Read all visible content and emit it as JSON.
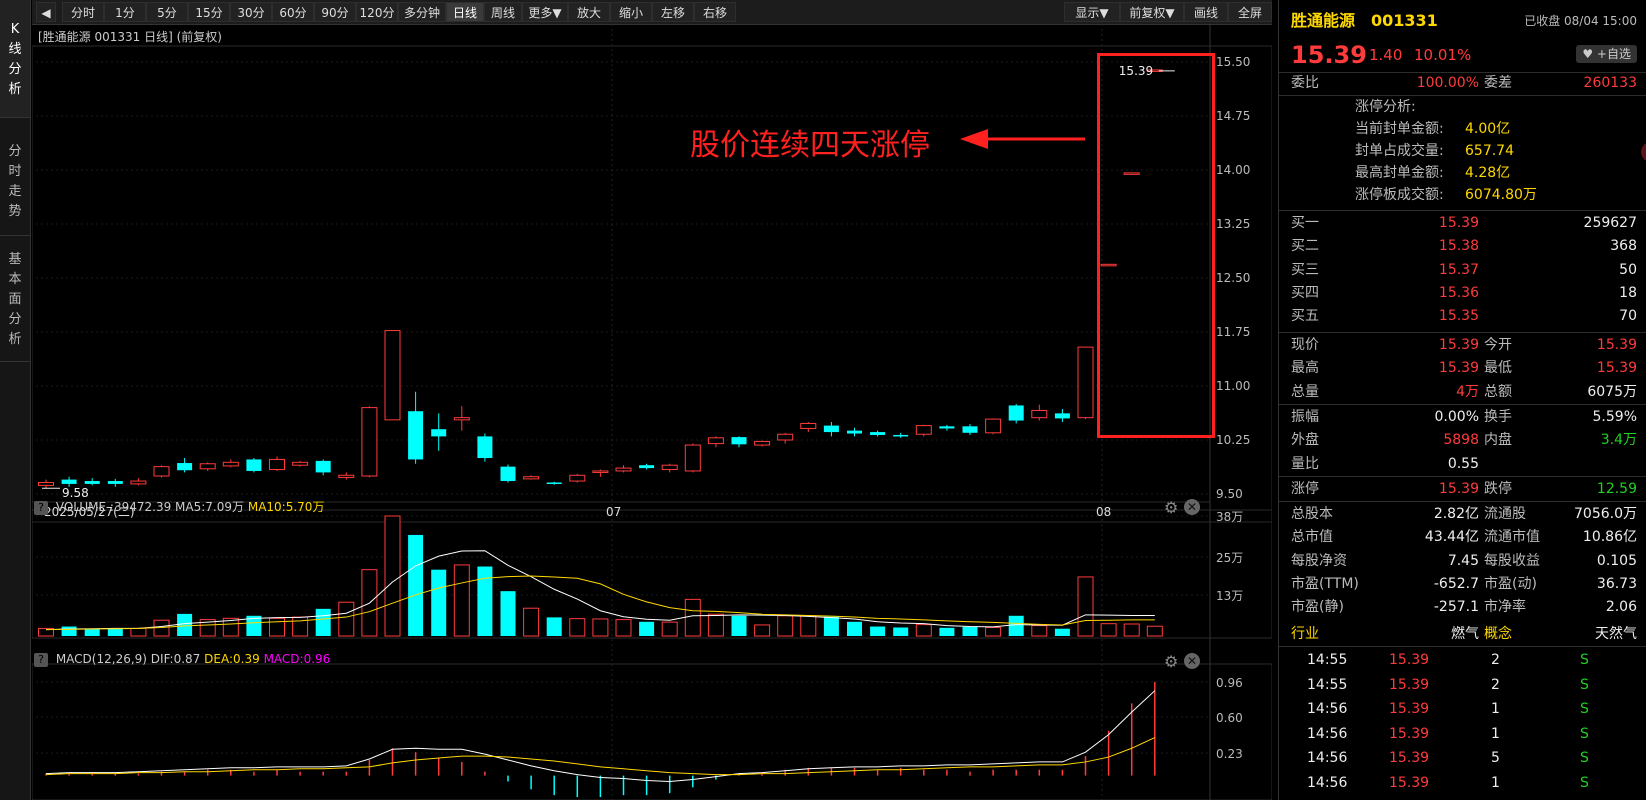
{
  "toolbar": {
    "back_label": "◀",
    "items": [
      "分时",
      "1分",
      "5分",
      "15分",
      "30分",
      "60分",
      "90分",
      "120分",
      "多分钟",
      "日线",
      "周线",
      "更多▼",
      "放大",
      "缩小",
      "左移",
      "右移"
    ],
    "right_items": [
      "显示▼",
      "前复权▼",
      "画线",
      "全屏"
    ]
  },
  "side_tabs": [
    {
      "label": "K线分析"
    },
    {
      "label": "分时走势"
    },
    {
      "label": "基本面分析"
    }
  ],
  "kline": {
    "header": "[胜通能源 001331 日线] (前复权)",
    "annotation": "股价连续四天涨停",
    "last_price_label": "15.39",
    "low_label": "9.58",
    "date_labels": [
      "2025/05/27(二)",
      "07",
      "08"
    ],
    "y_ticks": [
      "15.50",
      "14.75",
      "14.00",
      "13.25",
      "12.50",
      "11.75",
      "11.00",
      "10.25",
      "9.50"
    ]
  },
  "volume": {
    "help": "?",
    "name": "VOLUME",
    "value": ":39472.39",
    "ma5": "MA5:7.09万",
    "ma10": "MA10:5.70万",
    "y_ticks": [
      "38万",
      "25万",
      "13万"
    ]
  },
  "macd": {
    "help": "?",
    "name": "MACD(12,26,9)",
    "dif": "DIF:0.87",
    "dea": "DEA:0.39",
    "macd": "MACD:0.96",
    "y_ticks": [
      "0.96",
      "0.60",
      "0.23"
    ]
  },
  "colors": {
    "up": "#ff3b3b",
    "down": "#00ffff",
    "ma5": "#ffffff",
    "ma10": "#ffd800",
    "macd": "#ff00ff",
    "annotation": "#ff2020"
  },
  "quote": {
    "name": "胜通能源",
    "code": "001331",
    "status": "已收盘 08/04 15:00",
    "price": "15.39",
    "change": "1.40",
    "pct": "10.01%",
    "watch_button": "♥ +自选",
    "webi_label": "委比",
    "webi": "100.00%",
    "weicha_label": "委差",
    "weicha": "260133",
    "limit_title": "涨停分析:",
    "limit_rows": [
      {
        "label": "当前封单金额:",
        "value": "4.00亿"
      },
      {
        "label": "封单占成交量:",
        "value": "657.74"
      },
      {
        "label": "最高封单金额:",
        "value": "4.28亿"
      },
      {
        "label": "涨停板成交额:",
        "value": "6074.80万"
      }
    ],
    "bids": [
      {
        "label": "买一",
        "price": "15.39",
        "vol": "259627"
      },
      {
        "label": "买二",
        "price": "15.38",
        "vol": "368"
      },
      {
        "label": "买三",
        "price": "15.37",
        "vol": "50"
      },
      {
        "label": "买四",
        "price": "15.36",
        "vol": "18"
      },
      {
        "label": "买五",
        "price": "15.35",
        "vol": "70"
      }
    ],
    "stats": [
      {
        "l1": "现价",
        "v1": "15.39",
        "l2": "今开",
        "v2": "15.39"
      },
      {
        "l1": "最高",
        "v1": "15.39",
        "l2": "最低",
        "v2": "15.39"
      },
      {
        "l1": "总量",
        "v1": "4万",
        "l2": "总额",
        "v2": "6075万"
      }
    ],
    "stats2": [
      {
        "l1": "振幅",
        "v1": "0.00%",
        "l2": "换手",
        "v2": "5.59%"
      },
      {
        "l1": "外盘",
        "v1": "5898",
        "l2": "内盘",
        "v2": "3.4万"
      },
      {
        "l1": "量比",
        "v1": "0.55",
        "l2": "",
        "v2": ""
      }
    ],
    "limit_up_label": "涨停",
    "limit_up": "15.39",
    "limit_down_label": "跌停",
    "limit_down": "12.59",
    "fundamentals": [
      {
        "l1": "总股本",
        "v1": "2.82亿",
        "l2": "流通股",
        "v2": "7056.0万"
      },
      {
        "l1": "总市值",
        "v1": "43.44亿",
        "l2": "流通市值",
        "v2": "10.86亿"
      },
      {
        "l1": "每股净资",
        "v1": "7.45",
        "l2": "每股收益",
        "v2": "0.105"
      },
      {
        "l1": "市盈(TTM)",
        "v1": "-652.7",
        "l2": "市盈(动)",
        "v2": "36.73"
      },
      {
        "l1": "市盈(静)",
        "v1": "-257.1",
        "l2": "市净率",
        "v2": "2.06"
      }
    ],
    "industry_label": "行业",
    "industry": "燃气",
    "concept_label": "概念",
    "concept": "天然气",
    "ticks": [
      {
        "time": "14:55",
        "price": "15.39",
        "vol": "2",
        "side": "S"
      },
      {
        "time": "14:55",
        "price": "15.39",
        "vol": "2",
        "side": "S"
      },
      {
        "time": "14:56",
        "price": "15.39",
        "vol": "1",
        "side": "S"
      },
      {
        "time": "14:56",
        "price": "15.39",
        "vol": "1",
        "side": "S"
      },
      {
        "time": "14:56",
        "price": "15.39",
        "vol": "5",
        "side": "S"
      },
      {
        "time": "14:56",
        "price": "15.39",
        "vol": "1",
        "side": "S"
      }
    ]
  },
  "chart_data": [
    {
      "type": "candlestick",
      "title": "[胜通能源 001331 日线] (前复权)",
      "ylim": [
        9.5,
        15.5
      ],
      "candles": [
        [
          9.62,
          9.66,
          9.58,
          9.7
        ],
        [
          9.7,
          9.64,
          9.6,
          9.74
        ],
        [
          9.68,
          9.64,
          9.62,
          9.72
        ],
        [
          9.68,
          9.64,
          9.6,
          9.71
        ],
        [
          9.64,
          9.68,
          9.62,
          9.72
        ],
        [
          9.75,
          9.88,
          9.73,
          9.9
        ],
        [
          9.93,
          9.83,
          9.8,
          10.0
        ],
        [
          9.85,
          9.92,
          9.82,
          9.94
        ],
        [
          9.89,
          9.94,
          9.87,
          9.98
        ],
        [
          9.98,
          9.82,
          9.8,
          10.0
        ],
        [
          9.84,
          9.98,
          9.82,
          10.02
        ],
        [
          9.9,
          9.94,
          9.88,
          9.96
        ],
        [
          9.96,
          9.8,
          9.76,
          9.98
        ],
        [
          9.73,
          9.76,
          9.7,
          9.8
        ],
        [
          9.75,
          10.7,
          9.73,
          10.72
        ],
        [
          10.53,
          11.77,
          10.53,
          11.77
        ],
        [
          10.65,
          9.98,
          9.92,
          10.92
        ],
        [
          10.4,
          10.3,
          10.1,
          10.62
        ],
        [
          10.53,
          10.56,
          10.38,
          10.72
        ],
        [
          10.3,
          10.0,
          9.95,
          10.34
        ],
        [
          9.88,
          9.68,
          9.66,
          9.91
        ],
        [
          9.71,
          9.74,
          9.7,
          9.76
        ],
        [
          9.66,
          9.64,
          9.63,
          9.67
        ],
        [
          9.68,
          9.76,
          9.66,
          9.78
        ],
        [
          9.8,
          9.82,
          9.74,
          9.84
        ],
        [
          9.82,
          9.86,
          9.8,
          9.9
        ],
        [
          9.9,
          9.86,
          9.84,
          9.92
        ],
        [
          9.84,
          9.9,
          9.8,
          9.92
        ],
        [
          9.82,
          10.18,
          9.8,
          10.2
        ],
        [
          10.2,
          10.28,
          10.15,
          10.3
        ],
        [
          10.29,
          10.19,
          10.15,
          10.3
        ],
        [
          10.18,
          10.23,
          10.16,
          10.24
        ],
        [
          10.25,
          10.33,
          10.2,
          10.35
        ],
        [
          10.41,
          10.48,
          10.36,
          10.5
        ],
        [
          10.45,
          10.36,
          10.3,
          10.5
        ],
        [
          10.38,
          10.34,
          10.3,
          10.42
        ],
        [
          10.36,
          10.32,
          10.3,
          10.38
        ],
        [
          10.32,
          10.3,
          10.28,
          10.35
        ],
        [
          10.33,
          10.45,
          10.3,
          10.46
        ],
        [
          10.44,
          10.41,
          10.38,
          10.46
        ],
        [
          10.44,
          10.35,
          10.32,
          10.47
        ],
        [
          10.35,
          10.54,
          10.33,
          10.55
        ],
        [
          10.73,
          10.52,
          10.48,
          10.75
        ],
        [
          10.56,
          10.66,
          10.52,
          10.74
        ],
        [
          10.62,
          10.55,
          10.5,
          10.68
        ],
        [
          10.56,
          11.54,
          10.54,
          11.54
        ],
        [
          12.69,
          12.69,
          12.69,
          12.69
        ],
        [
          13.96,
          13.96,
          13.96,
          13.96
        ],
        [
          15.39,
          15.39,
          15.39,
          15.39
        ]
      ]
    },
    {
      "type": "bar",
      "title": "VOLUME",
      "series": [
        {
          "name": "VOLUME",
          "values": [
            2.4,
            3.0,
            2.3,
            2.3,
            2.4,
            5.0,
            7.0,
            5.2,
            5.6,
            6.4,
            5.6,
            6.0,
            8.6,
            10.7,
            21.0,
            38.0,
            32.0,
            21.0,
            22.5,
            22.0,
            14.2,
            8.8,
            5.9,
            5.5,
            5.4,
            5.2,
            4.5,
            4.4,
            11.6,
            6.9,
            6.4,
            3.5,
            6.4,
            6.4,
            6.1,
            4.5,
            3.0,
            2.7,
            3.6,
            2.6,
            2.9,
            2.7,
            6.4,
            3.3,
            2.3,
            18.7,
            3.9,
            3.8,
            3.1
          ]
        },
        {
          "name": "MA5",
          "values": [
            2.0,
            2.2,
            2.3,
            2.4,
            2.4,
            3.0,
            3.9,
            4.4,
            4.9,
            5.6,
            5.8,
            5.9,
            6.4,
            7.2,
            10.4,
            17.1,
            22.2,
            25.3,
            26.9,
            27.0,
            22.4,
            18.8,
            14.8,
            11.7,
            8.0,
            6.1,
            5.3,
            5.0,
            6.4,
            6.5,
            6.7,
            6.6,
            6.5,
            6.2,
            5.8,
            5.4,
            4.5,
            4.1,
            3.9,
            3.3,
            3.0,
            2.9,
            3.6,
            3.5,
            3.4,
            6.7,
            6.6,
            6.5,
            6.5
          ]
        },
        {
          "name": "MA10",
          "values": [
            2.0,
            2.1,
            2.2,
            2.3,
            2.4,
            2.7,
            3.2,
            3.5,
            3.8,
            4.2,
            4.5,
            4.8,
            5.4,
            6.0,
            7.7,
            10.4,
            13.0,
            15.2,
            16.8,
            18.3,
            18.8,
            19.0,
            18.7,
            18.3,
            16.5,
            13.2,
            10.8,
            9.0,
            8.0,
            7.8,
            7.4,
            6.9,
            6.7,
            6.5,
            6.3,
            6.0,
            5.6,
            5.4,
            5.1,
            4.8,
            4.5,
            4.3,
            4.0,
            3.7,
            3.5,
            4.9,
            5.0,
            5.1,
            5.1
          ]
        }
      ],
      "ylim": [
        0,
        38
      ]
    },
    {
      "type": "line",
      "title": "MACD(12,26,9)",
      "series": [
        {
          "name": "DIF",
          "values": [
            0.02,
            0.03,
            0.03,
            0.03,
            0.04,
            0.05,
            0.06,
            0.07,
            0.08,
            0.08,
            0.09,
            0.09,
            0.09,
            0.1,
            0.17,
            0.27,
            0.28,
            0.27,
            0.27,
            0.22,
            0.16,
            0.1,
            0.05,
            0.01,
            -0.02,
            -0.03,
            -0.05,
            -0.06,
            -0.04,
            -0.01,
            0.02,
            0.03,
            0.05,
            0.07,
            0.08,
            0.09,
            0.09,
            0.1,
            0.1,
            0.11,
            0.11,
            0.12,
            0.13,
            0.14,
            0.14,
            0.24,
            0.42,
            0.65,
            0.87
          ]
        },
        {
          "name": "DEA",
          "values": [
            0.01,
            0.02,
            0.02,
            0.02,
            0.03,
            0.03,
            0.04,
            0.04,
            0.05,
            0.06,
            0.06,
            0.07,
            0.07,
            0.08,
            0.09,
            0.13,
            0.16,
            0.18,
            0.2,
            0.2,
            0.19,
            0.17,
            0.15,
            0.12,
            0.09,
            0.07,
            0.05,
            0.03,
            0.02,
            0.01,
            0.01,
            0.02,
            0.02,
            0.03,
            0.04,
            0.05,
            0.06,
            0.06,
            0.07,
            0.08,
            0.09,
            0.09,
            0.1,
            0.11,
            0.11,
            0.14,
            0.19,
            0.28,
            0.39
          ]
        },
        {
          "name": "MACD",
          "values": [
            0.02,
            0.02,
            0.02,
            0.02,
            0.02,
            0.04,
            0.04,
            0.06,
            0.06,
            0.04,
            0.06,
            0.04,
            0.04,
            0.04,
            0.16,
            0.28,
            0.24,
            0.18,
            0.14,
            0.04,
            -0.06,
            -0.14,
            -0.2,
            -0.22,
            -0.22,
            -0.2,
            -0.2,
            -0.18,
            -0.12,
            -0.04,
            0.02,
            0.02,
            0.06,
            0.08,
            0.08,
            0.08,
            0.06,
            0.08,
            0.06,
            0.06,
            0.04,
            0.06,
            0.06,
            0.06,
            0.06,
            0.2,
            0.46,
            0.74,
            0.96
          ]
        }
      ],
      "ylim": [
        -0.25,
        1.0
      ]
    }
  ]
}
